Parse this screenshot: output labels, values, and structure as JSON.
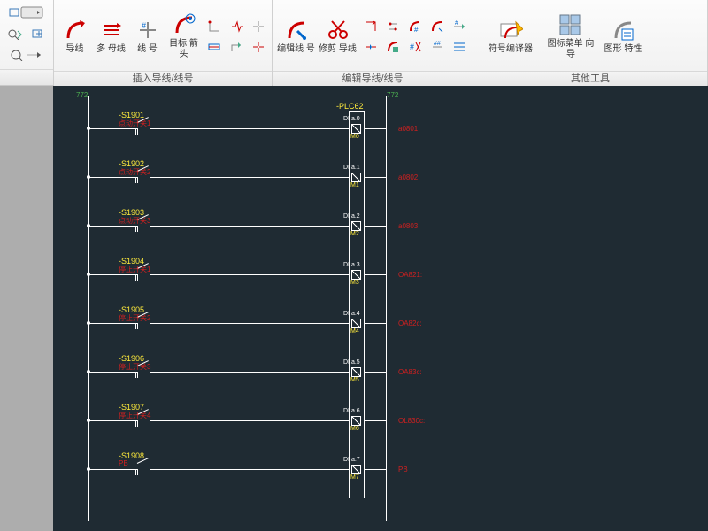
{
  "ribbon": {
    "panels": [
      {
        "title": "插入导线/线号",
        "big": [
          {
            "label": "导线"
          },
          {
            "label": "多\n母线"
          },
          {
            "label": "线\n号"
          },
          {
            "label": "目标\n箭头"
          }
        ]
      },
      {
        "title": "编辑导线/线号",
        "big": [
          {
            "label": "编辑线\n号"
          },
          {
            "label": "修剪\n导线"
          }
        ]
      },
      {
        "title": "其他工具",
        "big": [
          {
            "label": "符号编译器"
          },
          {
            "label": "图标菜单\n向导"
          },
          {
            "label": "图形\n特性"
          }
        ]
      }
    ]
  },
  "schematic": {
    "plc_label": "-PLC62",
    "left_bus_top": "772",
    "right_bus_top": "772",
    "rungs": [
      {
        "s": "-S1901",
        "desc": "点动开关1",
        "di": "DI a.0",
        "m": "M0",
        "far": "a0801:"
      },
      {
        "s": "-S1902",
        "desc": "点动开关2",
        "di": "DI a.1",
        "m": "M1",
        "far": "a0802:"
      },
      {
        "s": "-S1903",
        "desc": "点动开关3",
        "di": "DI a.2",
        "m": "M2",
        "far": "a0803:"
      },
      {
        "s": "-S1904",
        "desc": "停止开关1",
        "di": "DI a.3",
        "m": "M3",
        "far": "OA821:"
      },
      {
        "s": "-S1905",
        "desc": "停止开关2",
        "di": "DI a.4",
        "m": "M4",
        "far": "OA82c:"
      },
      {
        "s": "-S1906",
        "desc": "停止开关3",
        "di": "DI a.5",
        "m": "M5",
        "far": "OA83c:"
      },
      {
        "s": "-S1907",
        "desc": "停止开关4",
        "di": "DI a.6",
        "m": "M6",
        "far": "OL830c:"
      },
      {
        "s": "-S1908",
        "desc": "PB",
        "di": "DI a.7",
        "m": "M7",
        "far": "PB"
      }
    ]
  }
}
